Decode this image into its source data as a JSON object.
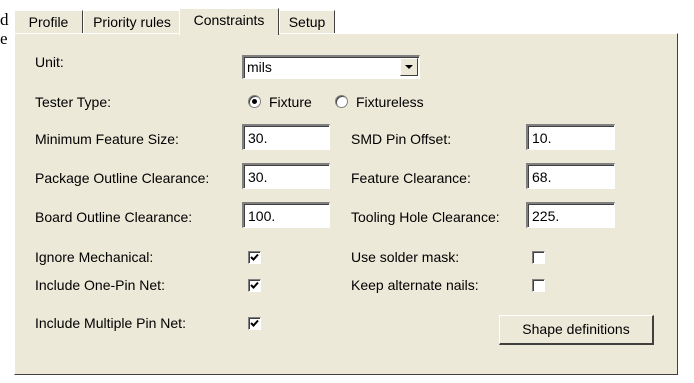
{
  "background_text": [
    "d",
    "e"
  ],
  "tabs": [
    {
      "label": "Profile",
      "active": false
    },
    {
      "label": "Priority rules",
      "active": false
    },
    {
      "label": "Constraints",
      "active": true
    },
    {
      "label": "Setup",
      "active": false
    }
  ],
  "unit": {
    "label": "Unit:",
    "value": "mils"
  },
  "tester_type": {
    "label": "Tester Type:",
    "options": [
      {
        "label": "Fixture",
        "selected": true
      },
      {
        "label": "Fixtureless",
        "selected": false
      }
    ]
  },
  "fields": {
    "min_feature_size": {
      "label": "Minimum Feature Size:",
      "value": "30."
    },
    "smd_pin_offset": {
      "label": "SMD Pin Offset:",
      "value": "10."
    },
    "package_outline_clearance": {
      "label": "Package Outline Clearance:",
      "value": "30."
    },
    "feature_clearance": {
      "label": "Feature Clearance:",
      "value": "68."
    },
    "board_outline_clearance": {
      "label": "Board Outline Clearance:",
      "value": "100."
    },
    "tooling_hole_clearance": {
      "label": "Tooling Hole Clearance:",
      "value": "225."
    }
  },
  "checkboxes": {
    "ignore_mechanical": {
      "label": "Ignore Mechanical:",
      "checked": true
    },
    "include_one_pin_net": {
      "label": "Include One-Pin Net:",
      "checked": true
    },
    "include_multiple_pin_net": {
      "label": "Include Multiple Pin Net:",
      "checked": true
    },
    "use_solder_mask": {
      "label": "Use solder mask:",
      "checked": false
    },
    "keep_alternate_nails": {
      "label": "Keep alternate nails:",
      "checked": false
    }
  },
  "buttons": {
    "shape_definitions": "Shape definitions"
  },
  "icons": {
    "combo_arrow": "chevron-down-icon",
    "check": "check-icon"
  },
  "colors": {
    "dialog_face": "#ece9d8",
    "field_bg": "#ffffff",
    "shadow": "#404040"
  }
}
